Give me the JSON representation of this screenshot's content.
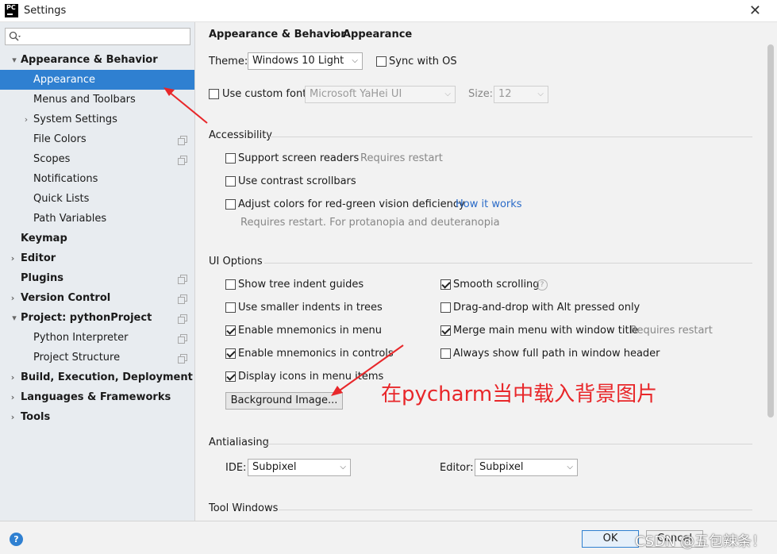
{
  "window": {
    "title": "Settings",
    "app_icon_text": "PC"
  },
  "sidebar": {
    "items": [
      {
        "label": "Appearance & Behavior"
      },
      {
        "label": "Appearance"
      },
      {
        "label": "Menus and Toolbars"
      },
      {
        "label": "System Settings"
      },
      {
        "label": "File Colors"
      },
      {
        "label": "Scopes"
      },
      {
        "label": "Notifications"
      },
      {
        "label": "Quick Lists"
      },
      {
        "label": "Path Variables"
      },
      {
        "label": "Keymap"
      },
      {
        "label": "Editor"
      },
      {
        "label": "Plugins"
      },
      {
        "label": "Version Control"
      },
      {
        "label": "Project: pythonProject"
      },
      {
        "label": "Python Interpreter"
      },
      {
        "label": "Project Structure"
      },
      {
        "label": "Build, Execution, Deployment"
      },
      {
        "label": "Languages & Frameworks"
      },
      {
        "label": "Tools"
      }
    ]
  },
  "breadcrumb": {
    "parent": "Appearance & Behavior",
    "separator": "›",
    "current": "Appearance"
  },
  "theme": {
    "label": "Theme:",
    "value": "Windows 10 Light",
    "sync_label": "Sync with OS",
    "sync_checked": false
  },
  "font": {
    "label": "Use custom font:",
    "value": "Microsoft YaHei UI",
    "size_label": "Size:",
    "size_value": "12",
    "checked": false
  },
  "accessibility": {
    "title": "Accessibility",
    "screen_readers": "Support screen readers",
    "screen_readers_note": "Requires restart",
    "contrast_scrollbars": "Use contrast scrollbars",
    "red_green": "Adjust colors for red-green vision deficiency",
    "how_it_works": "How it works",
    "red_green_note": "Requires restart. For protanopia and deuteranopia"
  },
  "ui_options": {
    "title": "UI Options",
    "tree_indent": "Show tree indent guides",
    "smaller_indents": "Use smaller indents in trees",
    "mnemonics_menu": "Enable mnemonics in menu",
    "mnemonics_controls": "Enable mnemonics in controls",
    "icons_menu": "Display icons in menu items",
    "smooth_scrolling": "Smooth scrolling",
    "drag_drop": "Drag-and-drop with Alt pressed only",
    "merge_menu": "Merge main menu with window title",
    "merge_note": "Requires restart",
    "full_path": "Always show full path in window header",
    "background_button": "Background Image...",
    "help_q": "?"
  },
  "antialiasing": {
    "title": "Antialiasing",
    "ide_label": "IDE:",
    "ide_value": "Subpixel",
    "editor_label": "Editor:",
    "editor_value": "Subpixel"
  },
  "tool_windows": {
    "title": "Tool Windows"
  },
  "annotation": "在pycharm当中载入背景图片",
  "footer": {
    "help": "?",
    "ok": "OK",
    "cancel": "Cancel",
    "watermark": "CSDN @五包辣条！"
  },
  "colors": {
    "selection": "#2f80d1",
    "annotation": "#e8272a",
    "link": "#2a6bc8"
  }
}
